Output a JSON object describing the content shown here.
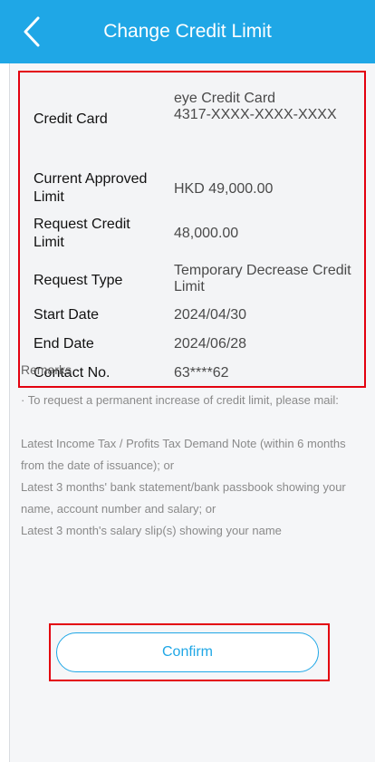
{
  "header": {
    "title": "Change Credit Limit"
  },
  "details": {
    "credit_card_label": "Credit Card",
    "credit_card_name": "eye Credit Card",
    "credit_card_number": "4317-XXXX-XXXX-XXXX",
    "approved_limit_label": "Current Approved Limit",
    "approved_limit_value": "HKD 49,000.00",
    "request_limit_label": "Request Credit Limit",
    "request_limit_value": "48,000.00",
    "request_type_label": "Request Type",
    "request_type_value": "Temporary Decrease Credit Limit",
    "start_date_label": "Start Date",
    "start_date_value": "2024/04/30",
    "end_date_label": "End Date",
    "end_date_value": "2024/06/28",
    "contact_label": "Contact No.",
    "contact_value": "63****62"
  },
  "remarks": {
    "title": "Remarks",
    "line1": "· To request a permanent increase of credit limit, please mail:",
    "line2": "Latest Income Tax / Profits Tax Demand Note (within 6 months from the date of issuance); or",
    "line3": "Latest 3 months' bank statement/bank passbook showing your name, account number and salary; or",
    "line4": "Latest 3 month's salary slip(s) showing your name"
  },
  "actions": {
    "confirm_label": "Confirm"
  },
  "colors": {
    "header": "#1fa7e6",
    "highlight": "#e3000f"
  }
}
